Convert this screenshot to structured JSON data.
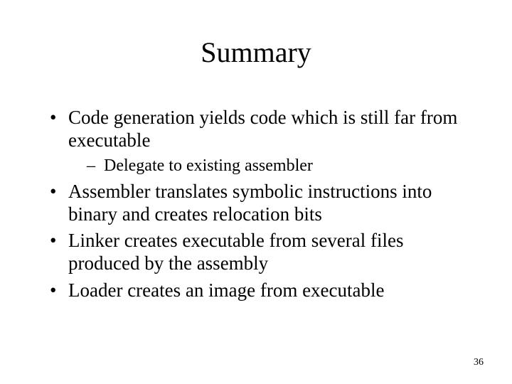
{
  "title": "Summary",
  "bullets": [
    {
      "text": "Code generation yields code which is still far from executable",
      "sub": [
        "Delegate to existing assembler"
      ]
    },
    {
      "text": "Assembler translates symbolic instructions into binary and creates relocation bits",
      "sub": []
    },
    {
      "text": "Linker creates executable from several files produced by the assembly",
      "sub": []
    },
    {
      "text": "Loader creates an image from executable",
      "sub": []
    }
  ],
  "page_number": "36"
}
